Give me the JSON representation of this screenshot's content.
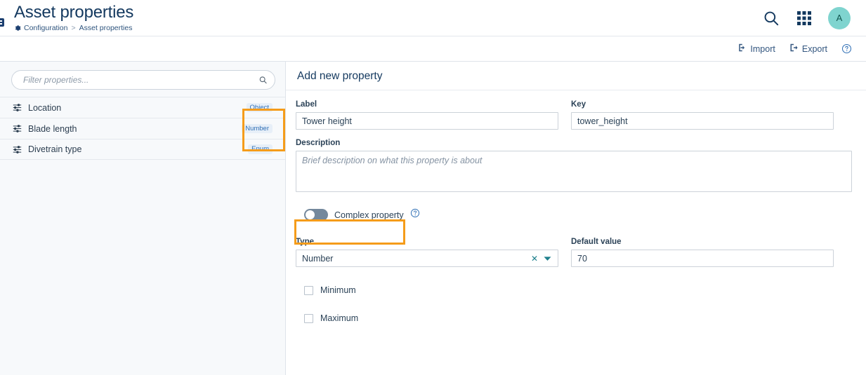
{
  "header": {
    "title": "Asset properties",
    "breadcrumb": {
      "gear_icon": "gear-icon",
      "parent": "Configuration",
      "separator": ">",
      "current": "Asset properties"
    },
    "search_icon": "search-icon",
    "apps_icon": "apps-grid-icon",
    "avatar_initial": "A",
    "avatar_color": "#7fd4cf"
  },
  "toolbar": {
    "import_label": "Import",
    "import_icon": "import-icon",
    "export_label": "Export",
    "export_icon": "export-icon",
    "help_icon": "help-circle-icon"
  },
  "sidebar": {
    "filter": {
      "placeholder": "Filter properties...",
      "value": "",
      "search_icon": "search-icon"
    },
    "properties": [
      {
        "name": "Location",
        "type_badge": "Object",
        "icon": "sliders-icon"
      },
      {
        "name": "Blade length",
        "type_badge": "Number",
        "icon": "sliders-icon"
      },
      {
        "name": "Divetrain type",
        "type_badge": "Enum",
        "icon": "sliders-icon"
      }
    ]
  },
  "main": {
    "title": "Add new property",
    "label_field": {
      "label": "Label",
      "value": "Tower height",
      "placeholder": ""
    },
    "key_field": {
      "label": "Key",
      "value": "tower_height",
      "placeholder": ""
    },
    "description_field": {
      "label": "Description",
      "value": "",
      "placeholder": "Brief description on what this property is about"
    },
    "complex_property": {
      "label": "Complex property",
      "state": "off",
      "help_icon": "help-circle-icon"
    },
    "type_field": {
      "label": "Type",
      "value": "Number",
      "clear_icon": "clear-x-icon",
      "caret_icon": "chevron-down-icon"
    },
    "default_value_field": {
      "label": "Default value",
      "value": "70",
      "placeholder": ""
    },
    "minimum": {
      "label": "Minimum",
      "checked": false
    },
    "maximum": {
      "label": "Maximum",
      "checked": false
    }
  },
  "annotations": {
    "highlight_color": "#f59c1a",
    "badges_highlight": "type-badges",
    "toggle_highlight": "complex-property-toggle"
  }
}
